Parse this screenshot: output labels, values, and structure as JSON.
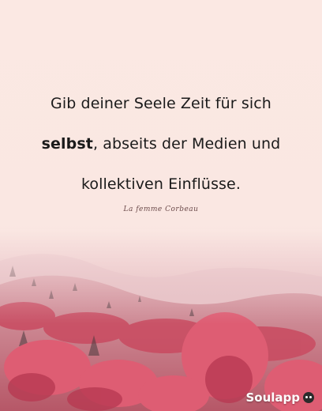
{
  "quote": {
    "line1": "Gib deiner Seele Zeit für sich",
    "line2_bold": "selbst",
    "line2_rest": ", abseits der Medien und",
    "line3": "kollektiven Einflüsse."
  },
  "signature": "La femme Corbeau",
  "brand": {
    "name": "Soulapp",
    "icon": "soulapp-logo-icon"
  },
  "colors": {
    "background": "#fbe9e4",
    "foliage": "#d9536a",
    "mist": "#f0d6d8"
  }
}
